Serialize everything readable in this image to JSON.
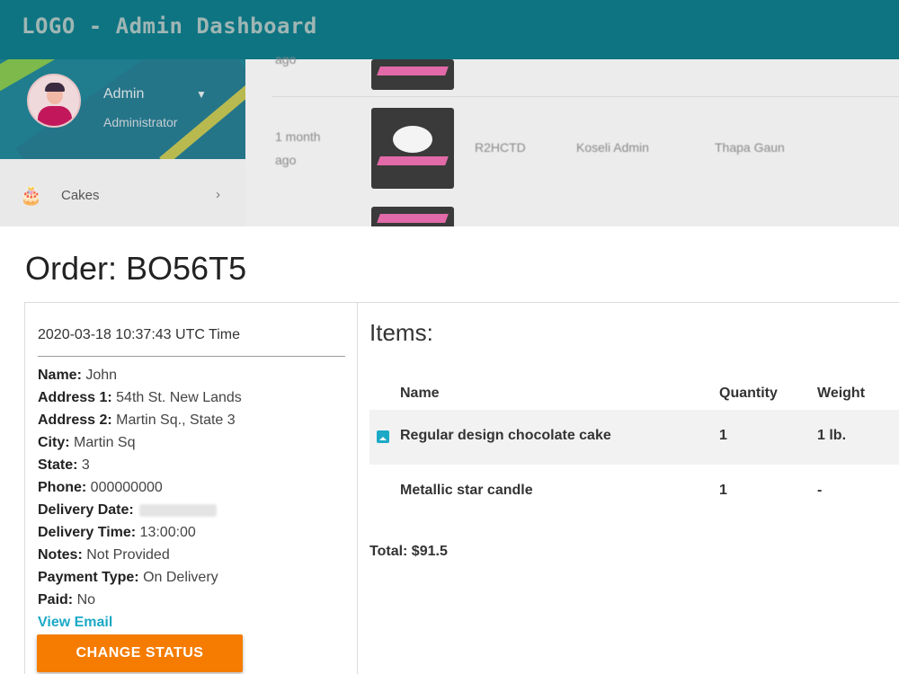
{
  "app": {
    "title": "LOGO - Admin Dashboard",
    "profile": {
      "name": "Admin",
      "role": "Administrator"
    },
    "sidebar_items": [
      {
        "label": "Cakes",
        "icon": "cake-icon"
      }
    ],
    "background_rows": [
      {
        "time": "ago",
        "code": "",
        "creator": "",
        "location": ""
      },
      {
        "time_line1": "1 month",
        "time_line2": "ago",
        "code": "R2HCTD",
        "creator": "Koseli Admin",
        "location": "Thapa Gaun"
      }
    ]
  },
  "order": {
    "title": "Order: BO56T5",
    "datetime": "2020-03-18 10:37:43 UTC Time",
    "fields": [
      {
        "label": "Name:",
        "value": "John"
      },
      {
        "label": "Address 1:",
        "value": "54th St. New Lands"
      },
      {
        "label": "Address 2:",
        "value": "Martin Sq., State 3"
      },
      {
        "label": "City:",
        "value": "Martin Sq"
      },
      {
        "label": "State:",
        "value": "3"
      },
      {
        "label": "Phone:",
        "value": "000000000"
      },
      {
        "label": "Delivery Date:",
        "value": ""
      },
      {
        "label": "Delivery Time:",
        "value": "13:00:00"
      },
      {
        "label": "Notes:",
        "value": "Not Provided"
      },
      {
        "label": "Payment Type:",
        "value": "On Delivery"
      },
      {
        "label": "Paid:",
        "value": "No"
      }
    ],
    "view_email_label": "View Email",
    "change_status_label": "CHANGE STATUS",
    "items_title": "Items:",
    "columns": {
      "name": "Name",
      "quantity": "Quantity",
      "weight": "Weight"
    },
    "items": [
      {
        "name": "Regular design chocolate cake",
        "quantity": "1",
        "weight": "1 lb.",
        "has_image": true
      },
      {
        "name": "Metallic star candle",
        "quantity": "1",
        "weight": "-",
        "has_image": false
      }
    ],
    "total": "Total: $91.5"
  },
  "colors": {
    "topbar": "#0e7482",
    "accent": "#1ba9c6",
    "status_button": "#f57c00"
  }
}
